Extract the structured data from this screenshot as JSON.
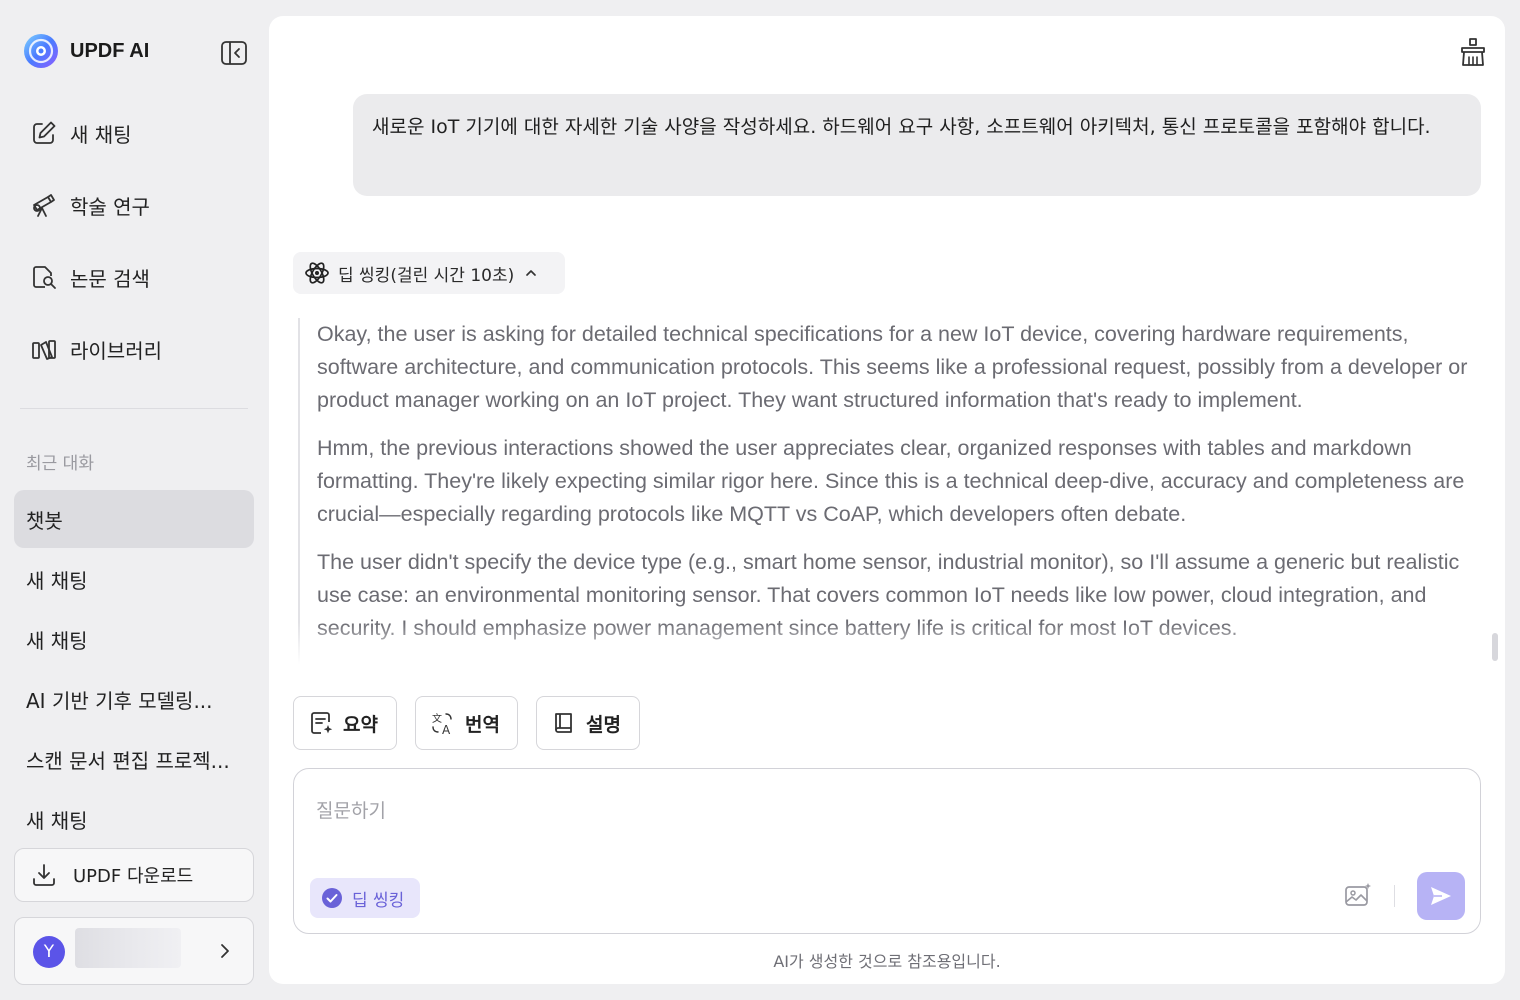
{
  "brand": {
    "name": "UPDF AI"
  },
  "nav": [
    {
      "label": "새 채팅",
      "icon": "edit-icon"
    },
    {
      "label": "학술 연구",
      "icon": "telescope-icon"
    },
    {
      "label": "논문 검색",
      "icon": "doc-search-icon"
    },
    {
      "label": "라이브러리",
      "icon": "library-icon"
    }
  ],
  "recent": {
    "label": "최근 대화",
    "items": [
      "챗봇",
      "새 채팅",
      "새 채팅",
      "AI 기반 기후 모델링...",
      "스캔 문서 편집 프로젝...",
      "새 채팅"
    ],
    "active_index": 0
  },
  "download": {
    "label": "UPDF 다운로드"
  },
  "user": {
    "initial": "Y"
  },
  "conversation": {
    "user_message": "새로운 IoT 기기에 대한 자세한 기술 사양을 작성하세요. 하드웨어 요구 사항, 소프트웨어 아키텍처, 통신 프로토콜을 포함해야 합니다.",
    "thinking_label": "딥 씽킹(걸린 시간 10초)",
    "thinking_paragraphs": [
      "Okay, the user is asking for detailed technical specifications for a new IoT device, covering hardware requirements, software architecture, and communication protocols. This seems like a professional request, possibly from a developer or product manager working on an IoT project. They want structured information that's ready to implement.",
      "Hmm, the previous interactions showed the user appreciates clear, organized responses with tables and markdown formatting. They're likely expecting similar rigor here. Since this is a technical deep-dive, accuracy and completeness are crucial—especially regarding protocols like MQTT vs CoAP, which developers often debate.",
      "The user didn't specify the device type (e.g., smart home sensor, industrial monitor), so I'll assume a generic but realistic use case: an environmental monitoring sensor. That covers common IoT needs like low power, cloud integration, and security. I should emphasize power management since battery life is critical for most IoT devices."
    ]
  },
  "actions": {
    "summarize": "요약",
    "translate": "번역",
    "explain": "설명"
  },
  "composer": {
    "placeholder": "질문하기",
    "deep_thinking": "딥 씽킹"
  },
  "disclaimer": "AI가 생성한 것으로 참조용입니다.",
  "colors": {
    "accent": "#6a62d8",
    "send": "#b7b3f5",
    "avatar": "#5b54e8"
  }
}
